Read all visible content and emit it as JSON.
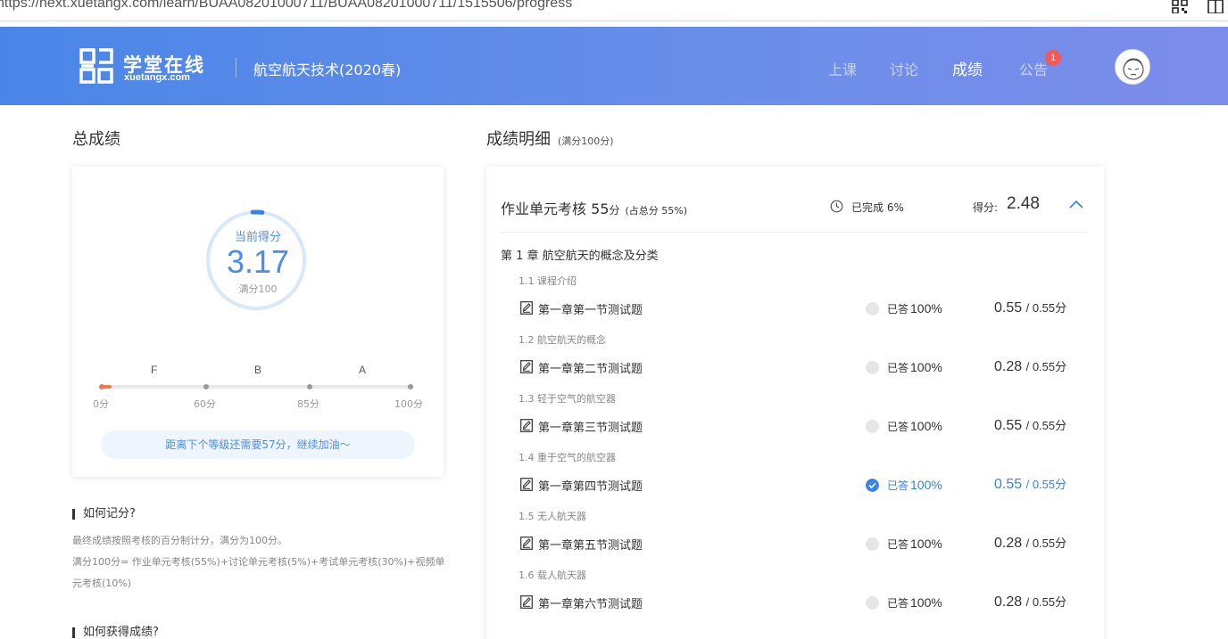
{
  "browser": {
    "url": "https://next.xuetangx.com/learn/BUAA08201000711/BUAA08201000711/1515506/progress"
  },
  "header": {
    "brand": "学堂在线",
    "brand_sub": "xuetangx.com",
    "course": "航空航天技术(2020春)",
    "nav": [
      "上课",
      "讨论",
      "成绩",
      "公告"
    ],
    "active_nav": "成绩",
    "notice_badge": "1"
  },
  "left": {
    "title": "总成绩",
    "current_label": "当前得分",
    "current_score": "3.17",
    "full_label": "满分100",
    "grades": [
      "F",
      "B",
      "A"
    ],
    "ticks": [
      "0分",
      "60分",
      "85分",
      "100分"
    ],
    "progress_value": 3.17,
    "tip": "距离下个等级还需要57分，继续加油～",
    "how_title": "如何记分?",
    "how_text_1": "最终成绩按照考核的百分制计分，满分为100分。",
    "how_text_2": "满分100分= 作业单元考核(55%)+讨论单元考核(5%)+考试单元考核(30%)+视频单元考核(10%)",
    "get_title": "如何获得成绩?"
  },
  "right": {
    "title": "成绩明细",
    "subtitle": "(满分100分)",
    "unit": {
      "name": "作业单元考核",
      "points": "55",
      "points_unit": "分",
      "pct": "(占总分 55%)",
      "done_label": "已完成",
      "done_pct": "6%",
      "score_label": "得分:",
      "score": "2.48"
    },
    "chapter": "第 1 章  航空航天的概念及分类",
    "sections": [
      {
        "name": "1.1 课程介绍",
        "quiz": "第一章第一节测试题",
        "status": "已答",
        "pct": "100%",
        "score": "0.55",
        "max": "/ 0.55分",
        "highlight": false
      },
      {
        "name": "1.2 航空航天的概念",
        "quiz": "第一章第二节测试题",
        "status": "已答",
        "pct": "100%",
        "score": "0.28",
        "max": "/ 0.55分",
        "highlight": false
      },
      {
        "name": "1.3 轻于空气的航空器",
        "quiz": "第一章第三节测试题",
        "status": "已答",
        "pct": "100%",
        "score": "0.55",
        "max": "/ 0.55分",
        "highlight": false
      },
      {
        "name": "1.4 重于空气的航空器",
        "quiz": "第一章第四节测试题",
        "status": "已答",
        "pct": "100%",
        "score": "0.55",
        "max": "/ 0.55分",
        "highlight": true
      },
      {
        "name": "1.5 无人航天器",
        "quiz": "第一章第五节测试题",
        "status": "已答",
        "pct": "100%",
        "score": "0.28",
        "max": "/ 0.55分",
        "highlight": false
      },
      {
        "name": "1.6 载人航天器",
        "quiz": "第一章第六节测试题",
        "status": "已答",
        "pct": "100%",
        "score": "0.28",
        "max": "/ 0.55分",
        "highlight": false
      }
    ]
  },
  "colors": {
    "accent": "#3b82e8",
    "orange": "#f5784a",
    "badge": "#f25a5a"
  },
  "icons": {
    "qr": "qr-code-icon",
    "reader": "reader-mode-icon",
    "clock": "clock-icon",
    "chevron": "chevron-up-icon",
    "quiz": "edit-document-icon",
    "check": "check-circle-icon"
  }
}
